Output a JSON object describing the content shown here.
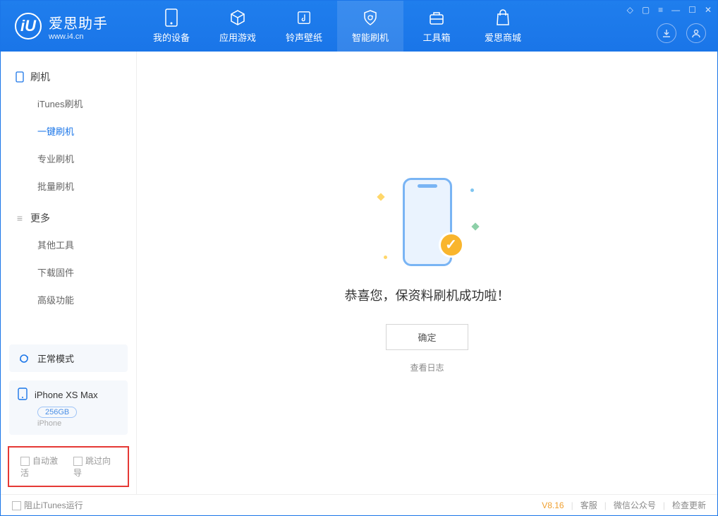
{
  "app": {
    "name_cn": "爱思助手",
    "url": "www.i4.cn"
  },
  "tabs": [
    {
      "label": "我的设备"
    },
    {
      "label": "应用游戏"
    },
    {
      "label": "铃声壁纸"
    },
    {
      "label": "智能刷机"
    },
    {
      "label": "工具箱"
    },
    {
      "label": "爱思商城"
    }
  ],
  "sidebar": {
    "section1": {
      "title": "刷机",
      "items": [
        "iTunes刷机",
        "一键刷机",
        "专业刷机",
        "批量刷机"
      ]
    },
    "section2": {
      "title": "更多",
      "items": [
        "其他工具",
        "下载固件",
        "高级功能"
      ]
    },
    "mode_label": "正常模式",
    "device": {
      "name": "iPhone XS Max",
      "storage": "256GB",
      "type": "iPhone"
    },
    "opts": {
      "auto_activate": "自动激活",
      "skip_guide": "跳过向导"
    }
  },
  "main": {
    "success_title": "恭喜您，保资料刷机成功啦！",
    "ok_button": "确定",
    "view_log": "查看日志"
  },
  "footer": {
    "block_itunes": "阻止iTunes运行",
    "version": "V8.16",
    "support": "客服",
    "wechat": "微信公众号",
    "update": "检查更新"
  }
}
